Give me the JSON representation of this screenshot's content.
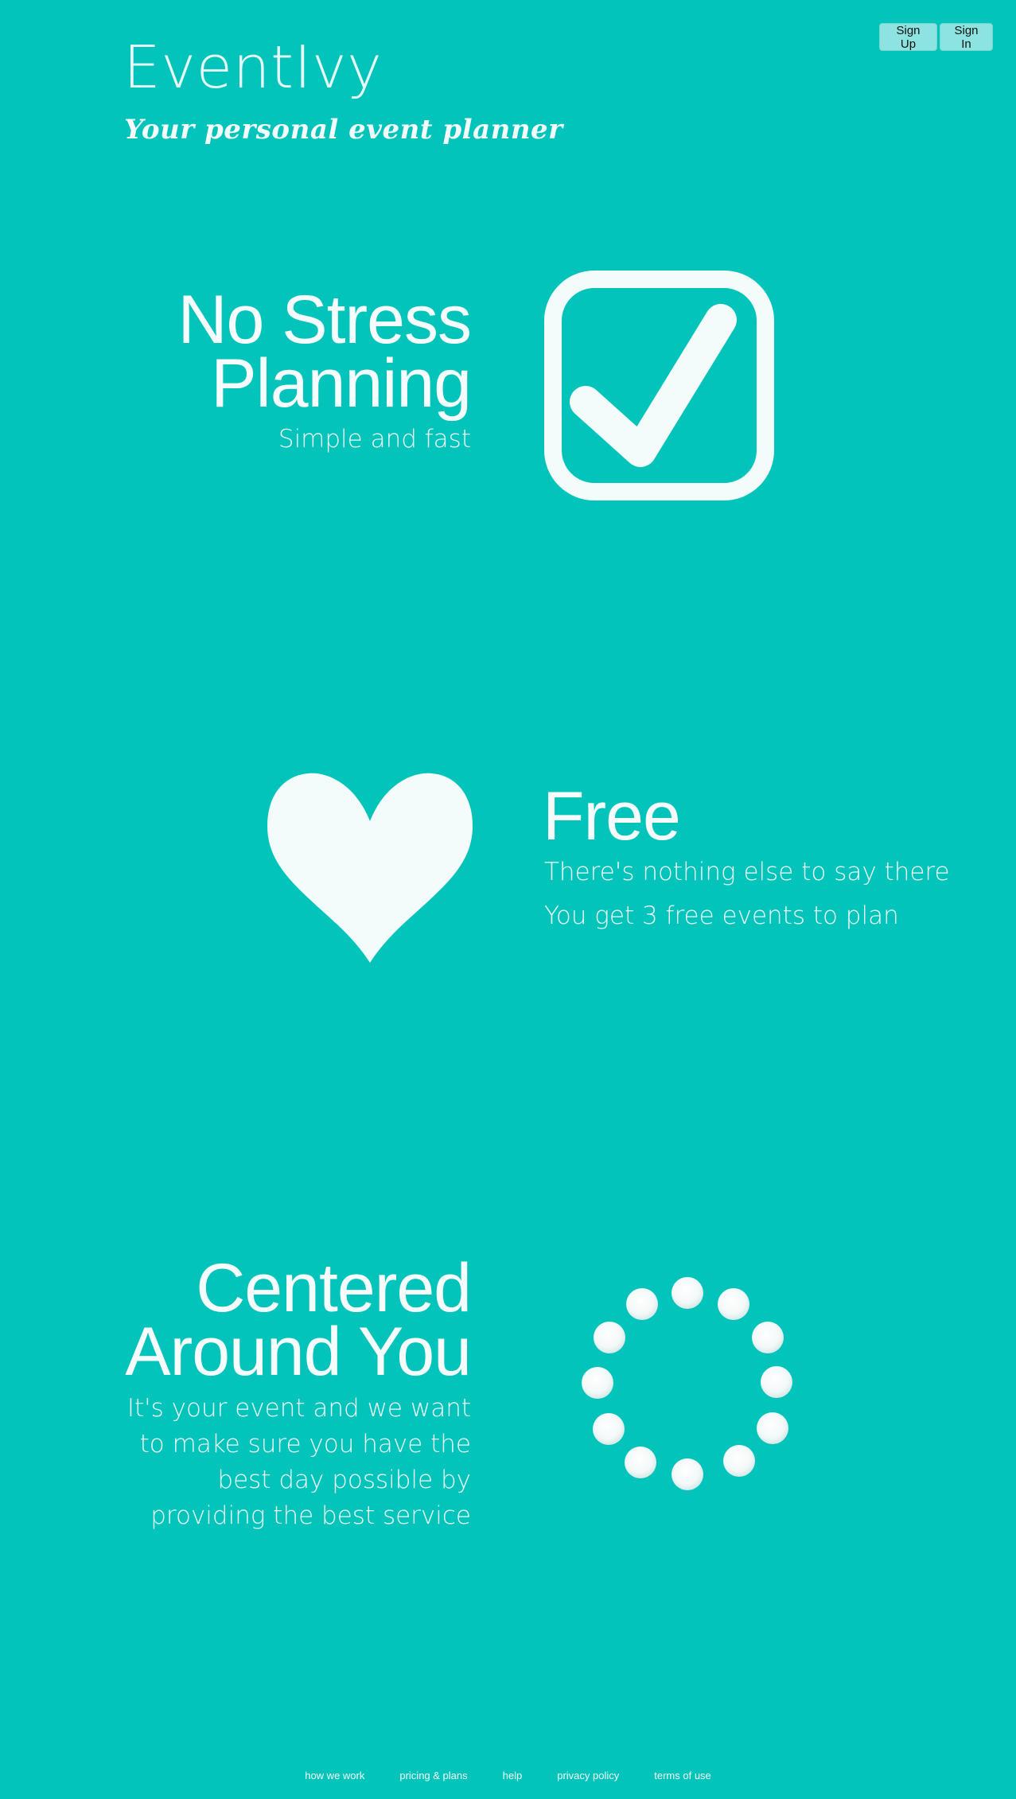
{
  "header": {
    "title": "EventIvy",
    "tagline": "Your personal event planner"
  },
  "auth": {
    "sign_up": "Sign Up",
    "sign_in": "Sign In"
  },
  "features": [
    {
      "title_line1": "No Stress",
      "title_line2": "Planning",
      "subtitle": "Simple and fast",
      "icon": "checkbox-checked-icon"
    },
    {
      "title": "Free",
      "line1": "There's nothing else to say there",
      "line2": "You get 3 free events to plan",
      "icon": "heart-icon"
    },
    {
      "title_line1": "Centered",
      "title_line2": "Around You",
      "subtitle": "It's your event and we want to make sure you have the best day possible by providing the best service",
      "icon": "loading-spinner-icon"
    }
  ],
  "footer": {
    "links": [
      "how we work",
      "pricing & plans",
      "help",
      "privacy policy",
      "terms of use"
    ]
  },
  "colors": {
    "background": "#02c4bb",
    "foreground": "#f4fbfb",
    "button": "#8de3df"
  }
}
